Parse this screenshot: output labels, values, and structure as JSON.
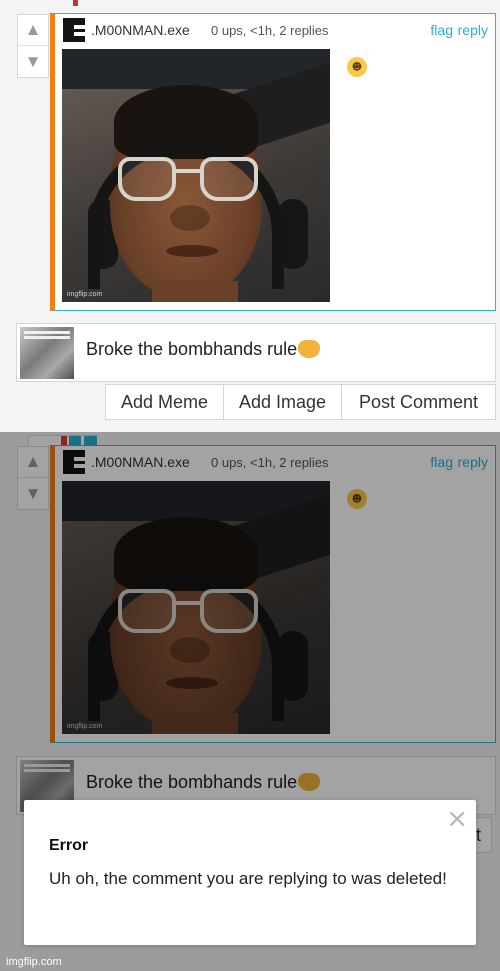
{
  "comment": {
    "username": ".M00NMAN.exe",
    "meta": "0 ups, <1h, 2 replies",
    "flag_label": "flag",
    "reply_label": "reply",
    "photo_watermark": "imgflip.com",
    "reaction_emoji": "nerd-face"
  },
  "reply_box": {
    "text": "Broke the bombhands rule",
    "emoji": "oncoming-fist"
  },
  "actions": {
    "add_meme": "Add Meme",
    "add_image": "Add Image",
    "post_comment": "Post Comment"
  },
  "error_modal": {
    "title": "Error",
    "message": "Uh oh, the comment you are replying to was deleted!",
    "close_label": "×"
  },
  "footer": {
    "watermark": "imgflip.com"
  },
  "colors": {
    "link": "#2ab0d6",
    "comment_border": "#2eb3dc",
    "comment_accent": "#f07f1a",
    "modal_overlay": "rgba(0,0,0,0.36)"
  },
  "background_partial": {
    "post_partial": "t",
    "reply_partial": "ply"
  }
}
